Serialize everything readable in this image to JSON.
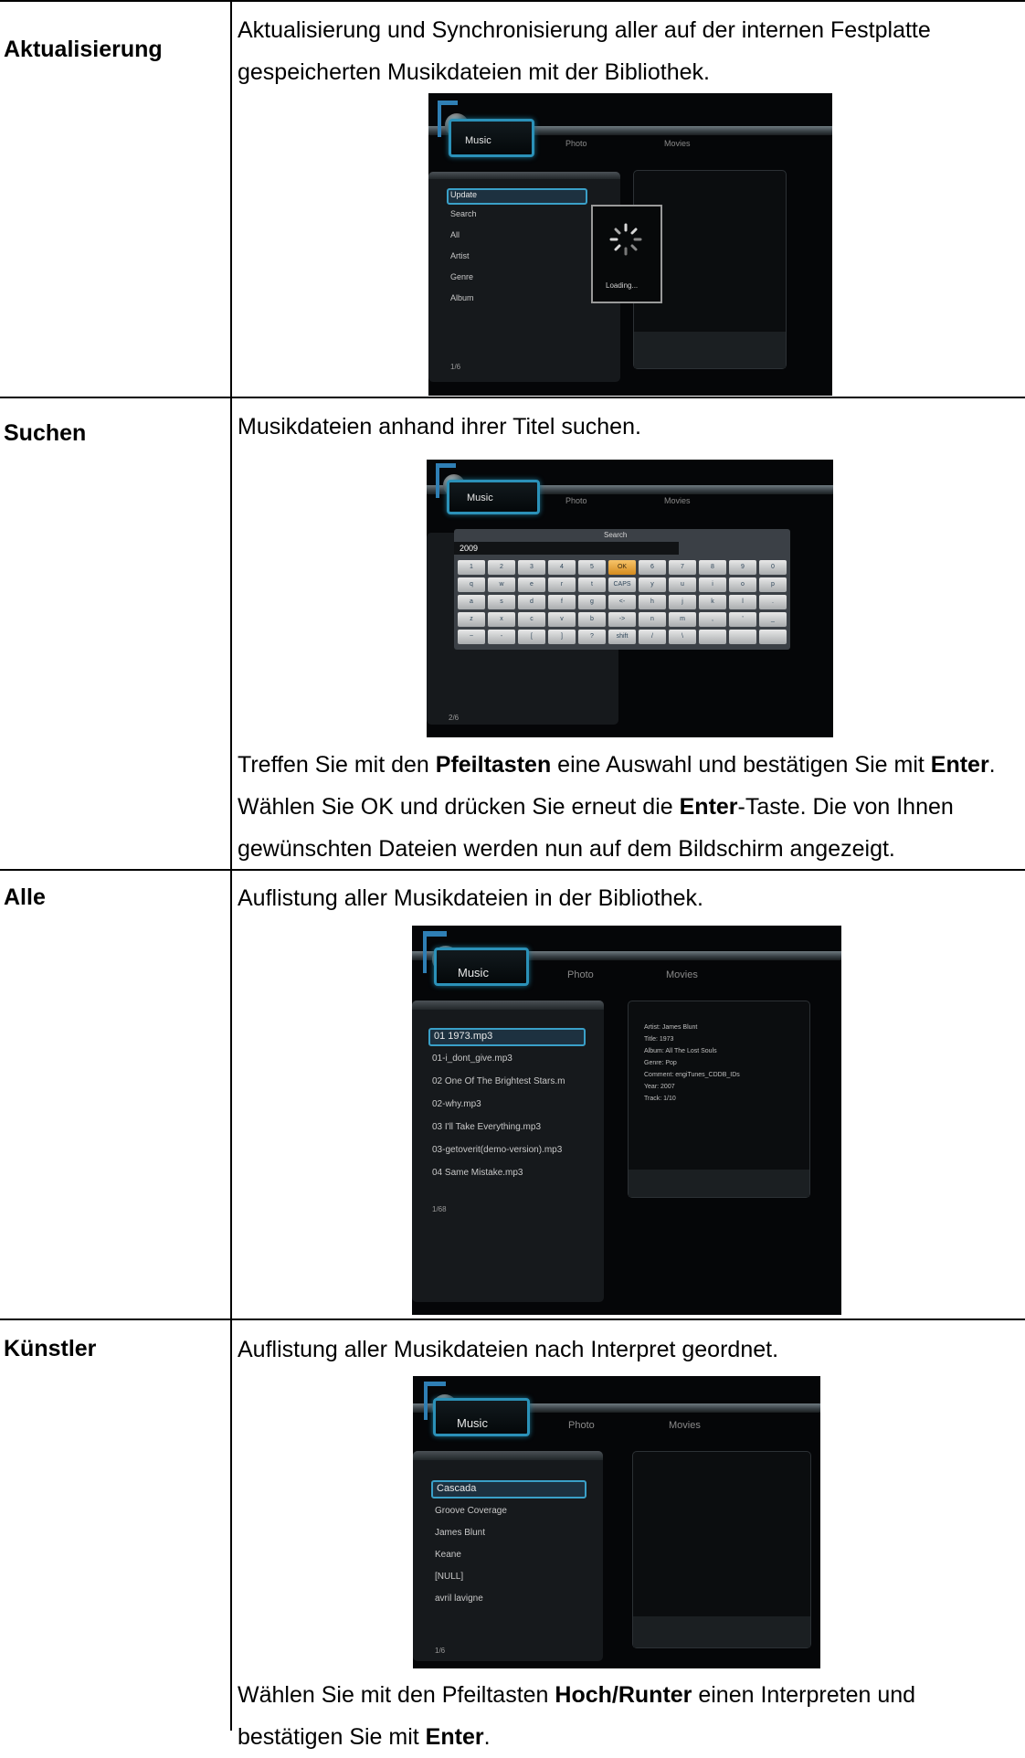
{
  "rows": [
    {
      "label": "Aktualisierung",
      "text": "Aktualisierung und Synchronisierung aller auf der internen Festplatte gespeicherten Musikdateien mit der Bibliothek.",
      "screen": {
        "tabs": [
          "Music",
          "Photo",
          "Movies"
        ],
        "menu": [
          "Update",
          "Search",
          "All",
          "Artist",
          "Genre",
          "Album"
        ],
        "page": "1/6",
        "loading": "Loading..."
      }
    },
    {
      "label": "Suchen",
      "text": "Musikdateien anhand ihrer Titel suchen.",
      "screen": {
        "tabs": [
          "Music",
          "Photo",
          "Movies"
        ],
        "search_title": "Search",
        "search_value": "2009",
        "page": "2/6",
        "keys": [
          [
            "1",
            "2",
            "3",
            "4",
            "5",
            "OK",
            "6",
            "7",
            "8",
            "9",
            "0"
          ],
          [
            "q",
            "w",
            "e",
            "r",
            "t",
            "CAPS",
            "y",
            "u",
            "i",
            "o",
            "p"
          ],
          [
            "a",
            "s",
            "d",
            "f",
            "g",
            "<-",
            "h",
            "j",
            "k",
            "l",
            "."
          ],
          [
            "z",
            "x",
            "c",
            "v",
            "b",
            "->",
            "n",
            "m",
            ",",
            "'",
            "_"
          ],
          [
            "~",
            "-",
            "[",
            "]",
            "?",
            "shift",
            "/",
            "\\",
            "",
            "",
            ""
          ]
        ]
      },
      "after": {
        "p1": "Treffen Sie mit den ",
        "b1": "Pfeiltasten",
        "p2": " eine Auswahl und bestätigen Sie mit ",
        "b2": "Enter",
        "p3": ". Wählen Sie OK und drücken Sie erneut die ",
        "b3": "Enter",
        "p4": "-Taste. Die von Ihnen gewünschten Dateien werden nun auf dem Bildschirm angezeigt."
      }
    },
    {
      "label": "Alle",
      "text": "Auflistung aller Musikdateien in der Bibliothek.",
      "screen": {
        "tabs": [
          "Music",
          "Photo",
          "Movies"
        ],
        "files": [
          "01 1973.mp3",
          "01-i_dont_give.mp3",
          "02 One Of The Brightest Stars.m",
          "02-why.mp3",
          "03 I'll Take Everything.mp3",
          "03-getoverit(demo-version).mp3",
          "04 Same Mistake.mp3"
        ],
        "page": "1/68",
        "info": [
          "Artist: James Blunt",
          "Title: 1973",
          "Album: All The Lost Souls",
          "Genre: Pop",
          "Comment: engiTunes_CDDB_IDs",
          "Year: 2007",
          "Track: 1/10"
        ]
      }
    },
    {
      "label": "Künstler",
      "text": "Auflistung aller Musikdateien nach Interpret geordnet.",
      "screen": {
        "tabs": [
          "Music",
          "Photo",
          "Movies"
        ],
        "artists": [
          "Cascada",
          "Groove Coverage",
          "James Blunt",
          "Keane",
          "[NULL]",
          "avril lavigne"
        ],
        "page": "1/6"
      },
      "after": {
        "p1": "Wählen Sie mit den Pfeiltasten ",
        "b1": "Hoch/Runter",
        "p2": " einen Interpreten und bestätigen Sie mit ",
        "b2": "Enter",
        "p3": "."
      }
    }
  ]
}
